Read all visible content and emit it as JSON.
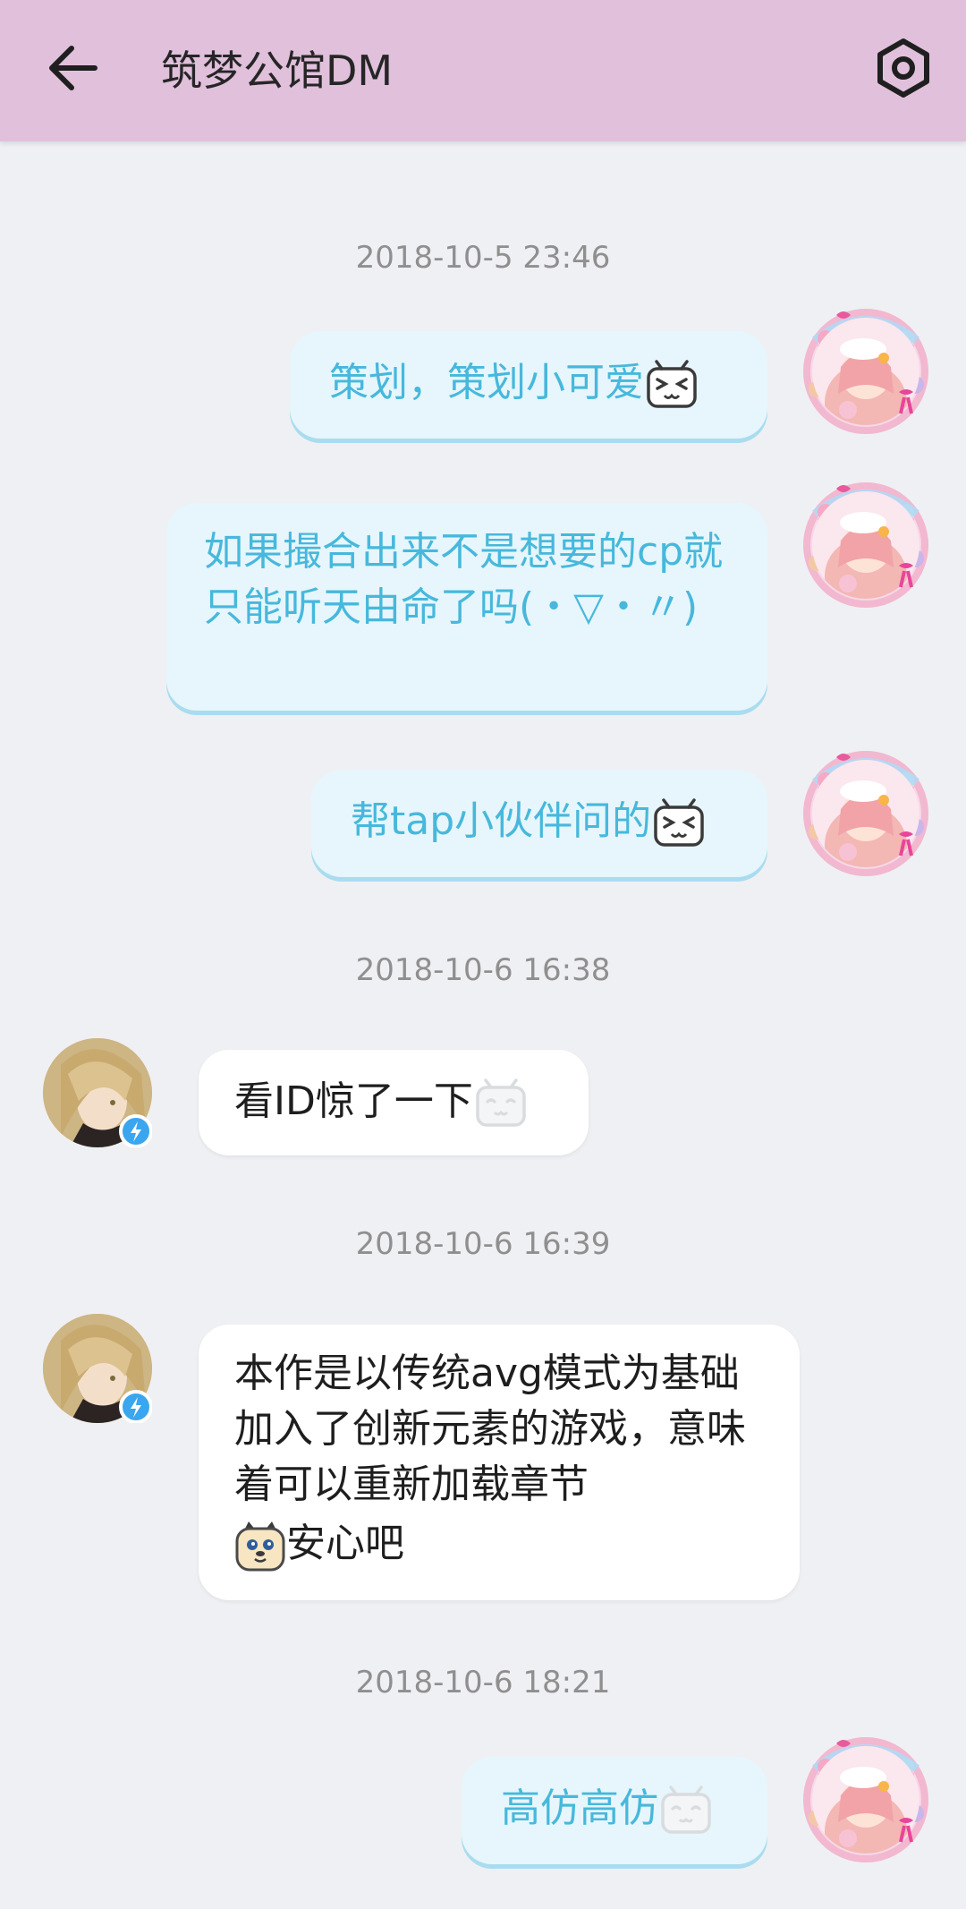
{
  "header": {
    "title": "筑梦公馆DM"
  },
  "messages": [
    {
      "time": "2018-10-5 23:46"
    },
    {
      "text": "策划，策划小可爱",
      "sender": "me",
      "emoji": "tv-laugh-emoji"
    },
    {
      "text": "如果撮合出来不是想要的cp就只能听天由命了吗(・▽・〃)",
      "sender": "me"
    },
    {
      "text": "帮tap小伙伴问的",
      "sender": "me",
      "emoji": "tv-laugh-emoji"
    },
    {
      "time": "2018-10-6 16:38"
    },
    {
      "text": "看ID惊了一下",
      "sender": "other",
      "emoji": "tv-smile-emoji"
    },
    {
      "time": "2018-10-6 16:39"
    },
    {
      "text": "本作是以传统avg模式为基础加入了创新元素的游戏，意味着可以重新加载章节",
      "text2": "安心吧",
      "sender": "other",
      "emoji": "dog-emoji"
    },
    {
      "time": "2018-10-6 18:21"
    },
    {
      "text": "高仿高仿",
      "sender": "me",
      "emoji": "tv-smile-emoji"
    }
  ],
  "colors": {
    "header_bg": "#e1c0dc",
    "my_bubble_bg": "#e6f6fc",
    "my_text": "#47b8dc",
    "their_bubble_bg": "#ffffff",
    "verified_badge": "#3aa6ef"
  }
}
